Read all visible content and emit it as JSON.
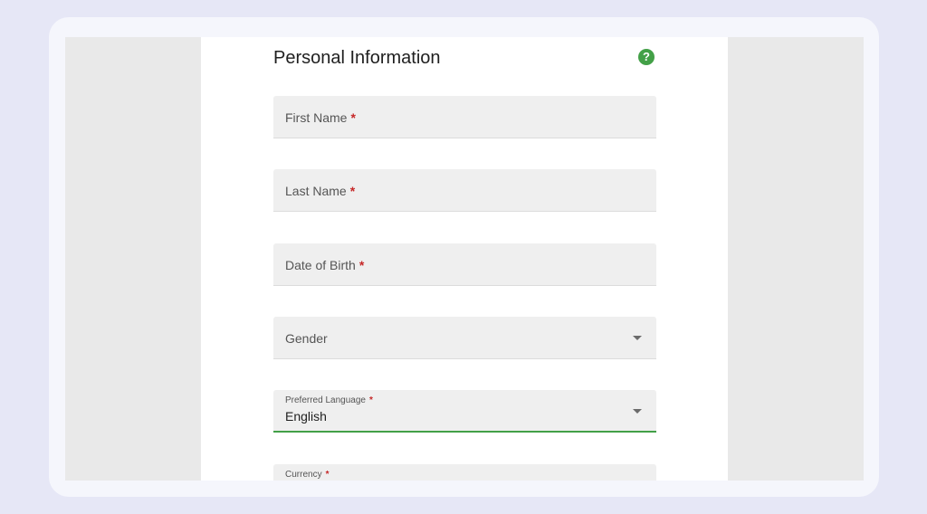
{
  "form": {
    "title": "Personal Information",
    "help_glyph": "?",
    "required_marker": "*",
    "fields": {
      "first_name": {
        "label": "First Name",
        "value": "",
        "required": true
      },
      "last_name": {
        "label": "Last Name",
        "value": "",
        "required": true
      },
      "date_of_birth": {
        "label": "Date of Birth",
        "value": "",
        "required": true
      },
      "gender": {
        "label": "Gender",
        "value": "",
        "required": false
      },
      "preferred_language": {
        "label": "Preferred Language",
        "value": "English",
        "required": true
      },
      "currency": {
        "label": "Currency",
        "value": "",
        "required": true
      }
    }
  },
  "colors": {
    "accent": "#43a047",
    "required": "#c62828",
    "field_background": "#efefef"
  },
  "icons": {
    "help": "help-circle-icon",
    "dropdown": "chevron-down-icon"
  }
}
